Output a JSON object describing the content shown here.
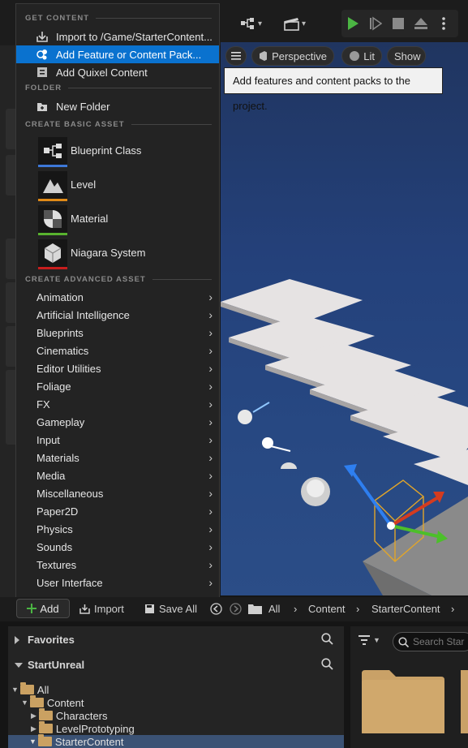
{
  "menu": {
    "sections": {
      "get_content": "GET CONTENT",
      "folder": "FOLDER",
      "basic": "CREATE BASIC ASSET",
      "advanced": "CREATE ADVANCED ASSET"
    },
    "import": "Import to /Game/StarterContent...",
    "add_feature": "Add Feature or Content Pack...",
    "add_quixel": "Add Quixel Content",
    "new_folder": "New Folder",
    "basic_assets": [
      {
        "label": "Blueprint Class",
        "color": "#3d78d8"
      },
      {
        "label": "Level",
        "color": "#e08a17"
      },
      {
        "label": "Material",
        "color": "#58b22e"
      },
      {
        "label": "Niagara System",
        "color": "#c81d1d"
      }
    ],
    "advanced_assets": [
      "Animation",
      "Artificial Intelligence",
      "Blueprints",
      "Cinematics",
      "Editor Utilities",
      "Foliage",
      "FX",
      "Gameplay",
      "Input",
      "Materials",
      "Media",
      "Miscellaneous",
      "Paper2D",
      "Physics",
      "Sounds",
      "Textures",
      "User Interface"
    ]
  },
  "viewport": {
    "perspective": "Perspective",
    "lit": "Lit",
    "show": "Show",
    "tooltip": "Add features and content packs to the project."
  },
  "content_browser": {
    "add": "Add",
    "import": "Import",
    "save_all": "Save All",
    "breadcrumb": [
      "All",
      "Content",
      "StarterContent"
    ],
    "favorites": "Favorites",
    "project": "StartUnreal",
    "search_placeholder": "Search Star",
    "tree": {
      "all": "All",
      "content": "Content",
      "characters": "Characters",
      "level_prototyping": "LevelPrototyping",
      "starter_content": "StarterContent"
    }
  },
  "icons": [
    "save-icon",
    "blueprint-icon",
    "cinematics-icon",
    "play-icon",
    "step-icon",
    "stop-icon",
    "eject-icon",
    "more-icon",
    "import-icon",
    "pack-icon",
    "quixel-icon",
    "new-folder-icon",
    "search-icon",
    "filter-icon",
    "folder-icon"
  ]
}
